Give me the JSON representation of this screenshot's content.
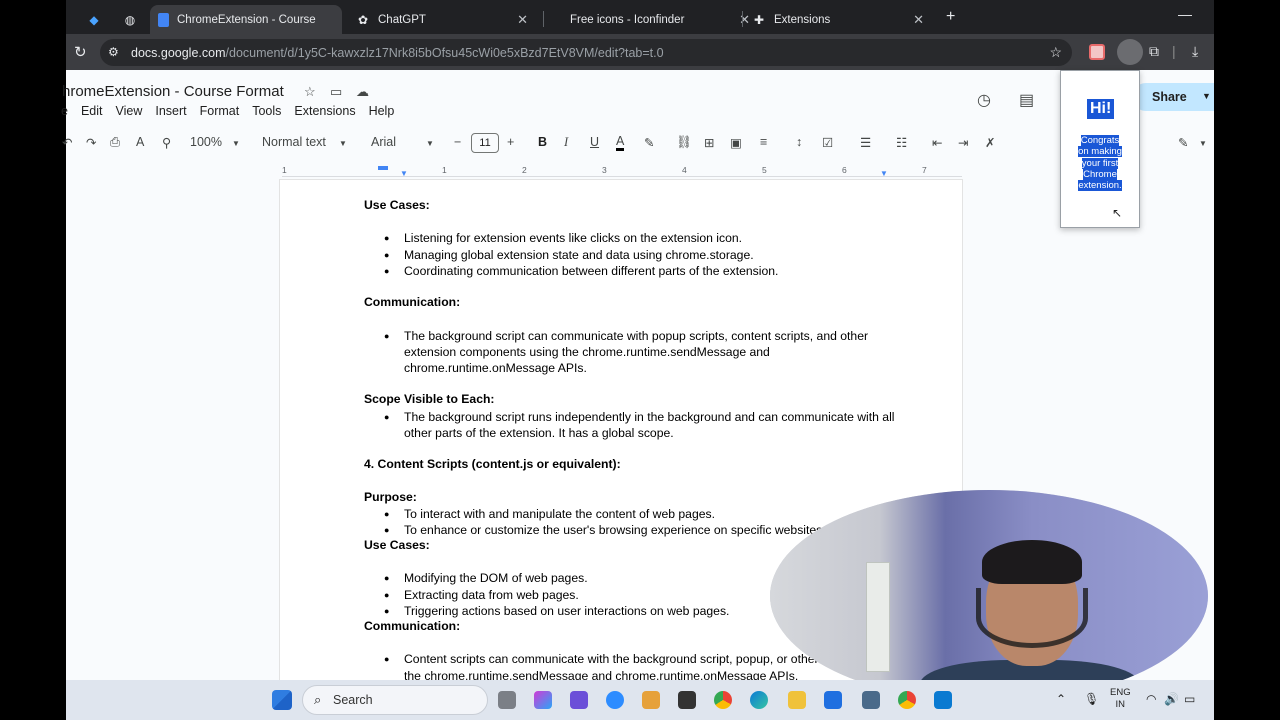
{
  "tabs": [
    {
      "title": "",
      "icon": "gem-icon"
    },
    {
      "title": "",
      "icon": "globe-icon"
    },
    {
      "title": "ChromeExtension - Course Form",
      "icon": "docs-icon",
      "active": true
    },
    {
      "title": "ChatGPT",
      "icon": "chatgpt-icon"
    },
    {
      "title": "Free icons - Iconfinder",
      "icon": "iconfinder-icon"
    },
    {
      "title": "Extensions",
      "icon": "puzzle-icon"
    }
  ],
  "address": {
    "host": "docs.google.com",
    "path": "/document/d/1y5C-kawxzlz17Nrk8i5bOfsu45cWi0e5xBzd7EtV8VM/edit?tab=t.0"
  },
  "docs": {
    "title": "hromeExtension - Course Format",
    "menu": [
      "e",
      "Edit",
      "View",
      "Insert",
      "Format",
      "Tools",
      "Extensions",
      "Help"
    ],
    "share_label": "Share",
    "toolbar": {
      "zoom": "100%",
      "style": "Normal text",
      "font": "Arial",
      "font_size": "11"
    },
    "ruler_numbers": [
      "1",
      "1",
      "2",
      "3",
      "4",
      "5",
      "6",
      "7"
    ]
  },
  "document": {
    "use_cases_1": "Use Cases:",
    "use_cases_1_items": [
      "Listening for extension events like clicks on the extension icon.",
      "Managing global extension state and data using chrome.storage.",
      "Coordinating communication between different parts of the extension."
    ],
    "communication_1": "Communication:",
    "communication_1_items": [
      "The background script can communicate with popup scripts, content scripts, and other extension components using the chrome.runtime.sendMessage and chrome.runtime.onMessage APIs."
    ],
    "scope": "Scope Visible to Each:",
    "scope_items": [
      "The background script runs independently in the background and can communicate with all other parts of the extension. It has a global scope."
    ],
    "content_scripts": "4. Content Scripts (content.js or equivalent):",
    "purpose": "Purpose:",
    "purpose_items": [
      "To interact with and manipulate the content of web pages.",
      "To enhance or customize the user's browsing experience on specific websites."
    ],
    "use_cases_2": "Use Cases:",
    "use_cases_2_items": [
      "Modifying the DOM of web pages.",
      "Extracting data from web pages.",
      "Triggering actions based on user interactions on web pages."
    ],
    "communication_2": "Communication:",
    "communication_2_items": [
      "Content scripts can communicate with the background script, popup, or other scripts using the chrome.runtime.sendMessage and chrome.runtime.onMessage APIs."
    ]
  },
  "popup": {
    "heading": "Hi!",
    "message": "Congrats on making your first Chrome extension."
  },
  "taskbar": {
    "search_label": "Search",
    "lang_line1": "ENG",
    "lang_line2": "IN"
  },
  "colors": {
    "accent": "#1a57d6",
    "share_bg": "#c2e7ff",
    "tab_strip": "#202124"
  }
}
